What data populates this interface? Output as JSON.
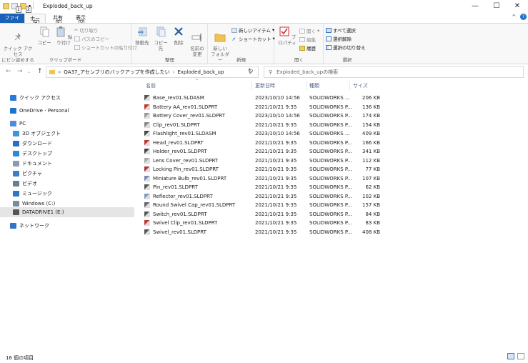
{
  "window": {
    "title": "Exploded_back_up"
  },
  "keytips": [
    "1",
    "2",
    "H",
    "S",
    "V"
  ],
  "tabs": {
    "file": "ファイル",
    "home": "ホーム",
    "share": "共有",
    "view": "表示"
  },
  "ribbon": {
    "clipboard": {
      "label": "クリップボード",
      "pin": "クイック アクセス\nにピン留めする",
      "copy": "コピー",
      "paste": "貼り付け",
      "cut": "切り取り",
      "copy_path": "パスのコピー",
      "paste_shortcut": "ショートカットの貼り付け"
    },
    "organize": {
      "label": "整理",
      "move_to": "移動先",
      "copy_to": "コピー先",
      "delete": "削除",
      "rename": "名前の\n変更"
    },
    "new": {
      "label": "新規",
      "new_folder": "新しい\nフォルダー",
      "new_item": "新しいアイテム",
      "easy_access": "ショートカット"
    },
    "open": {
      "label": "開く",
      "properties": "プロパティ",
      "open": "開く",
      "edit": "編集",
      "history": "履歴"
    },
    "select": {
      "label": "選択",
      "select_all": "すべて選択",
      "select_none": "選択解除",
      "invert": "選択の切り替え"
    }
  },
  "address": {
    "path_root": "QA37_アセンブリのバックアップを作成したい",
    "path_leaf": "Exploded_back_up",
    "search_placeholder": "Exploded_back_upの検索"
  },
  "nav": [
    {
      "label": "クイック アクセス",
      "icon": "star-icon",
      "color": "#2b79d6"
    },
    {
      "label": "OneDrive - Personal",
      "icon": "cloud-icon",
      "color": "#1e73d0"
    },
    {
      "label": "PC",
      "icon": "pc-icon",
      "color": "#4a8fd8"
    },
    {
      "label": "3D オブジェクト",
      "icon": "cube-icon",
      "color": "#3d97d6"
    },
    {
      "label": "ダウンロード",
      "icon": "download-icon",
      "color": "#2c6fc4"
    },
    {
      "label": "デスクトップ",
      "icon": "desktop-icon",
      "color": "#2c8ad8"
    },
    {
      "label": "ドキュメント",
      "icon": "document-icon",
      "color": "#8a9bb0"
    },
    {
      "label": "ピクチャ",
      "icon": "picture-icon",
      "color": "#3d7fc4"
    },
    {
      "label": "ビデオ",
      "icon": "video-icon",
      "color": "#6a7c96"
    },
    {
      "label": "ミュージック",
      "icon": "music-icon",
      "color": "#2f75c8"
    },
    {
      "label": "Windows (C:)",
      "icon": "drive-icon",
      "color": "#7a8aa0"
    },
    {
      "label": "DATADRIVE1 (E:)",
      "icon": "drive-icon",
      "color": "#555"
    },
    {
      "label": "ネットワーク",
      "icon": "network-icon",
      "color": "#2f75c8"
    }
  ],
  "columns": {
    "name": "名前",
    "date": "更新日時",
    "type": "種類",
    "size": "サイズ"
  },
  "files": [
    {
      "name": "Base_rev01.SLDASM",
      "date": "2023/10/10 14:56",
      "type": "SOLIDWORKS ...",
      "size": "206 KB",
      "color": "#555"
    },
    {
      "name": "Battery AA_rev01.SLDPRT",
      "date": "2021/10/21 9:35",
      "type": "SOLIDWORKS P...",
      "size": "136 KB",
      "color": "#c0392b"
    },
    {
      "name": "Battery Cover_rev01.SLDPRT",
      "date": "2023/10/10 14:56",
      "type": "SOLIDWORKS P...",
      "size": "174 KB",
      "color": "#999"
    },
    {
      "name": "Clip_rev01.SLDPRT",
      "date": "2021/10/21 9:35",
      "type": "SOLIDWORKS P...",
      "size": "154 KB",
      "color": "#888"
    },
    {
      "name": "Flashlight_rev01.SLDASM",
      "date": "2023/10/10 14:56",
      "type": "SOLIDWORKS ...",
      "size": "409 KB",
      "color": "#444"
    },
    {
      "name": "Head_rev01.SLDPRT",
      "date": "2021/10/21 9:35",
      "type": "SOLIDWORKS P...",
      "size": "166 KB",
      "color": "#c0392b"
    },
    {
      "name": "Holder_rev01.SLDPRT",
      "date": "2021/10/21 9:35",
      "type": "SOLIDWORKS P...",
      "size": "341 KB",
      "color": "#444"
    },
    {
      "name": "Lens Cover_rev01.SLDPRT",
      "date": "2021/10/21 9:35",
      "type": "SOLIDWORKS P...",
      "size": "112 KB",
      "color": "#aaa"
    },
    {
      "name": "Locking Pin_rev01.SLDPRT",
      "date": "2021/10/21 9:35",
      "type": "SOLIDWORKS P...",
      "size": "77 KB",
      "color": "#b03030"
    },
    {
      "name": "Miniature Bulb_rev01.SLDPRT",
      "date": "2021/10/21 9:35",
      "type": "SOLIDWORKS P...",
      "size": "107 KB",
      "color": "#7a8ab0"
    },
    {
      "name": "Pin_rev01.SLDPRT",
      "date": "2021/10/21 9:35",
      "type": "SOLIDWORKS P...",
      "size": "62 KB",
      "color": "#555"
    },
    {
      "name": "Reflector_rev01.SLDPRT",
      "date": "2021/10/21 9:35",
      "type": "SOLIDWORKS P...",
      "size": "102 KB",
      "color": "#7a9bc0"
    },
    {
      "name": "Round Swivel Cap_rev01.SLDPRT",
      "date": "2021/10/21 9:35",
      "type": "SOLIDWORKS P...",
      "size": "157 KB",
      "color": "#666"
    },
    {
      "name": "Switch_rev01.SLDPRT",
      "date": "2021/10/21 9:35",
      "type": "SOLIDWORKS P...",
      "size": "84 KB",
      "color": "#555"
    },
    {
      "name": "Swivel Clip_rev01.SLDPRT",
      "date": "2021/10/21 9:35",
      "type": "SOLIDWORKS P...",
      "size": "83 KB",
      "color": "#c0392b"
    },
    {
      "name": "Swivel_rev01.SLDPRT",
      "date": "2021/10/21 9:35",
      "type": "SOLIDWORKS P...",
      "size": "408 KB",
      "color": "#555"
    }
  ],
  "status": {
    "count": "16 個の項目"
  }
}
